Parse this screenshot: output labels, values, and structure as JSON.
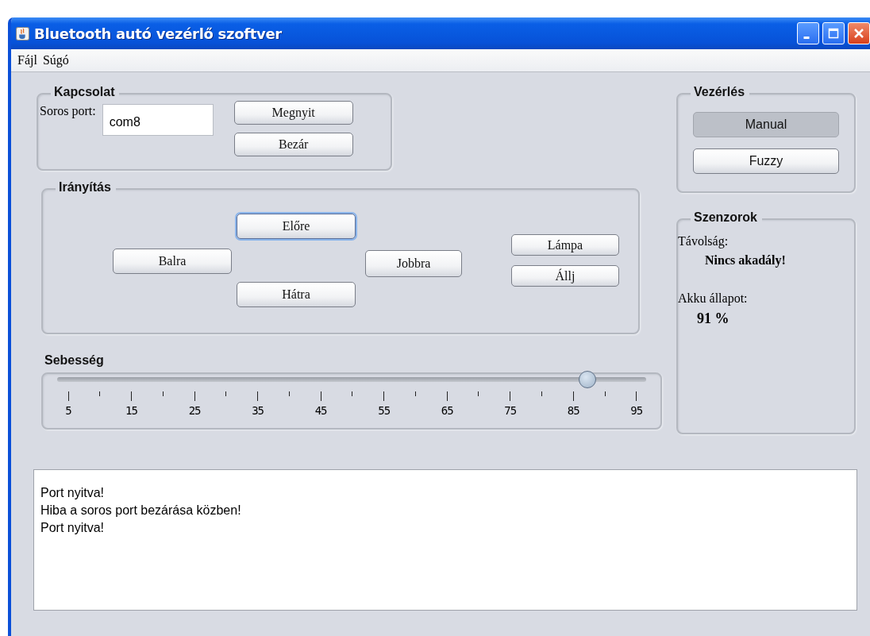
{
  "window": {
    "title": "Bluetooth autó vezérlő szoftver"
  },
  "menu": [
    {
      "label": "Fájl"
    },
    {
      "label": "Súgó"
    }
  ],
  "connection": {
    "title": "Kapcsolat",
    "port_label": "Soros port:",
    "port_value": "com8",
    "buttons": [
      {
        "label": "Megnyit"
      },
      {
        "label": "Bezár"
      }
    ]
  },
  "steering": {
    "title": "Irányítás",
    "columns": [
      {
        "buttons": [
          {
            "label": "Balra",
            "focused": false
          }
        ]
      },
      {
        "buttons": [
          {
            "label": "Előre",
            "focused": true
          },
          {
            "label": "Hátra",
            "focused": false
          }
        ]
      },
      {
        "buttons": [
          {
            "label": "Jobbra",
            "focused": false
          }
        ]
      },
      {
        "buttons": [
          {
            "label": "Lámpa",
            "focused": false
          },
          {
            "label": "Állj",
            "focused": false
          }
        ]
      }
    ]
  },
  "speed": {
    "title": "Sebesség",
    "level": 0.9,
    "ticks": [
      "5",
      "15",
      "25",
      "35",
      "45",
      "55",
      "65",
      "75",
      "85",
      "95"
    ]
  },
  "control": {
    "title": "Vezérlés",
    "modes": [
      {
        "label": "Manual",
        "selected": true
      },
      {
        "label": "Fuzzy",
        "selected": false
      }
    ]
  },
  "sensors": {
    "title": "Szenzorok",
    "distance_label": "Távolság:",
    "distance_value": "Nincs akadály!",
    "battery_label": "Akku állapot:",
    "battery_value": "91 %"
  },
  "log": {
    "lines": [
      "Port nyitva!",
      "Hiba a soros port bezárása közben!",
      "Port nyitva!"
    ]
  }
}
